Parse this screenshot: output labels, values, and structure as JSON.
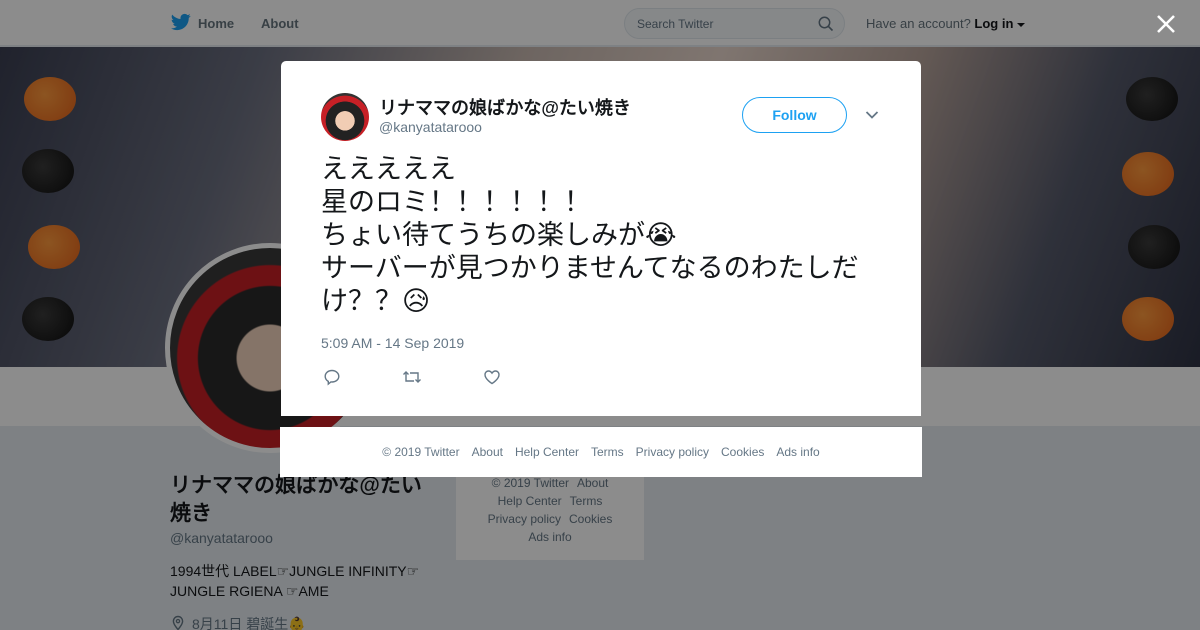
{
  "nav": {
    "home_label": "Home",
    "about_label": "About",
    "search_placeholder": "Search Twitter",
    "account_prompt": "Have an account?",
    "login_label": "Log in"
  },
  "profile": {
    "name": "リナママの娘ばかな@たい焼き",
    "handle": "@kanyatatarooo",
    "bio": "1994世代 LABEL☞JUNGLE INFINITY☞ JUNGLE RGIENA ☞AME",
    "location": "8月11日 碧誕生👶"
  },
  "page_footer": {
    "items": [
      "© 2019 Twitter",
      "About",
      "Help Center",
      "Terms",
      "Privacy policy",
      "Cookies",
      "Ads info"
    ]
  },
  "tweet": {
    "name": "リナママの娘ばかな@たい焼き",
    "handle": "@kanyatatarooo",
    "follow_label": "Follow",
    "text": "えええええ\n星のロミ！！！！！！\nちょい待てうちの楽しみが😭\nサーバーが見つかりませんてなるのわたしだけ？？😥",
    "timestamp": "5:09 AM - 14 Sep 2019"
  },
  "modal_footer": {
    "items": [
      "© 2019 Twitter",
      "About",
      "Help Center",
      "Terms",
      "Privacy policy",
      "Cookies",
      "Ads info"
    ]
  },
  "colors": {
    "accent": "#1da1f2",
    "secondary_text": "#657786",
    "overlay": "rgba(0,0,0,0.45)"
  },
  "icons": [
    "twitter-bird-icon",
    "home-icon",
    "search-icon",
    "caret-down-icon",
    "close-icon",
    "chevron-down-icon",
    "reply-icon",
    "retweet-icon",
    "like-icon",
    "location-icon"
  ]
}
